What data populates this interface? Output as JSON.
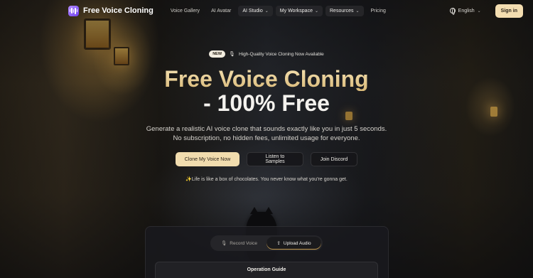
{
  "brand": {
    "name": "Free Voice Cloning",
    "accent": "#f1dcae",
    "logo_gradient": [
      "#b48cff",
      "#6f3ff0"
    ]
  },
  "nav": {
    "items": [
      {
        "label": "Voice Gallery",
        "dropdown": false,
        "pill": false
      },
      {
        "label": "AI Avatar",
        "dropdown": false,
        "pill": false
      },
      {
        "label": "AI Studio",
        "dropdown": true,
        "pill": true
      },
      {
        "label": "My Workspace",
        "dropdown": true,
        "pill": true
      },
      {
        "label": "Resources",
        "dropdown": true,
        "pill": true
      },
      {
        "label": "Pricing",
        "dropdown": false,
        "pill": false
      }
    ],
    "language": "English",
    "signin_label": "Sign in"
  },
  "hero": {
    "badge": "NEW",
    "announcement": "High-Quality Voice Cloning Now Available",
    "title_line1": "Free Voice Cloning",
    "title_line2": "- 100% Free",
    "subtitle_line1": "Generate a realistic AI voice clone that sounds exactly like you in just 5 seconds.",
    "subtitle_line2": "No subscription, no hidden fees, unlimited usage for everyone.",
    "cta_primary": "Clone My Voice Now",
    "cta_samples": "Listen to Samples",
    "cta_discord": "Join Discord",
    "quote": "✨Life is like a box of chocolates. You never know what you're gonna get."
  },
  "panel": {
    "tabs": [
      {
        "label": "Record Voice",
        "icon": "mic-icon",
        "active": false
      },
      {
        "label": "Upload Audio",
        "icon": "upload-icon",
        "active": true
      }
    ],
    "guide_title": "Operation Guide"
  }
}
